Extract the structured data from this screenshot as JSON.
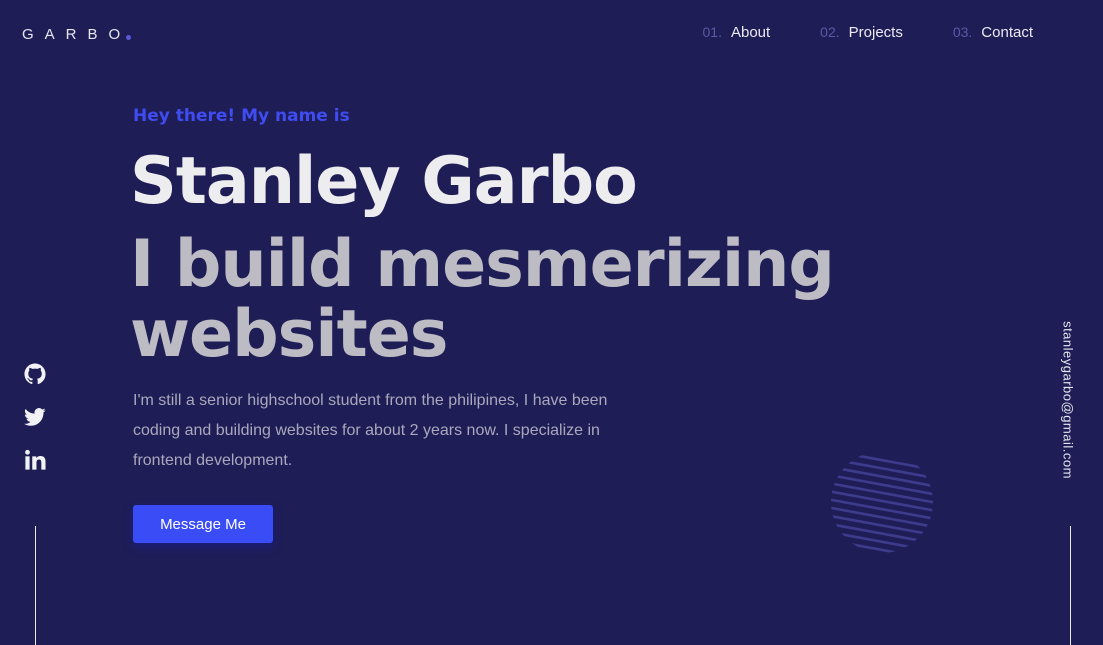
{
  "logo": {
    "text": "GARBO"
  },
  "nav": {
    "items": [
      {
        "num": "01.",
        "label": "About"
      },
      {
        "num": "02.",
        "label": "Projects"
      },
      {
        "num": "03.",
        "label": "Contact"
      }
    ]
  },
  "hero": {
    "greeting": "Hey there! My name is",
    "name": "Stanley Garbo",
    "tagline": "I build mesmerizing websites",
    "bio": "I'm still a senior highschool student from the philipines, I have been coding and building websites for about 2 years now. I specialize in frontend development.",
    "cta_label": "Message Me"
  },
  "socials": [
    {
      "icon": "github-icon"
    },
    {
      "icon": "twitter-icon"
    },
    {
      "icon": "linkedin-icon"
    }
  ],
  "email": "stanleygarbo@gmail.com",
  "colors": {
    "background": "#1f1d55",
    "accent": "#3a4cf5",
    "greeting": "#3f4cf2",
    "heading": "#ededf0",
    "subheading": "#bdbcc4",
    "body_text": "#a9a8bd",
    "nav_number": "#5a59a8"
  }
}
